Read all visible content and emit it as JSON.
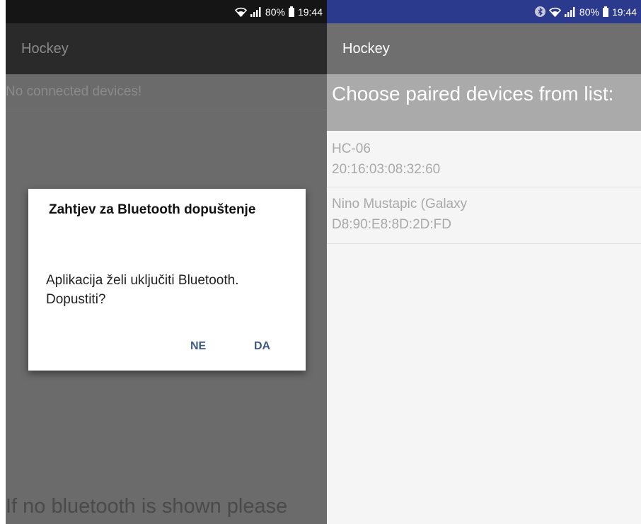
{
  "left_screen": {
    "status": {
      "battery": "80%",
      "time": "19:44"
    },
    "app_title": "Hockey",
    "no_devices_text": "No connected devices!",
    "bottom_hint": "If no bluetooth is shown please",
    "dialog": {
      "title": "Zahtjev za Bluetooth dopuštenje",
      "message": "Aplikacija želi uključiti Bluetooth. Dopustiti?",
      "negative_label": "NE",
      "positive_label": "DA"
    }
  },
  "right_screen": {
    "status": {
      "battery": "80%",
      "time": "19:44"
    },
    "app_title": "Hockey",
    "header_text": "Choose paired devices from list:",
    "devices": [
      {
        "name": "HC-06",
        "address": "20:16:03:08:32:60"
      },
      {
        "name": "Nino Mustapic (Galaxy",
        "address": "D8:90:E8:8D:2D:FD"
      }
    ]
  },
  "colors": {
    "left_statusbar": "#151515",
    "right_statusbar": "#2c3a8e",
    "dialog_button": "#3f5a80",
    "list_header": "#aaaaaa"
  },
  "icons": [
    "wifi-icon",
    "signal-icon",
    "battery-icon",
    "bluetooth-icon"
  ]
}
